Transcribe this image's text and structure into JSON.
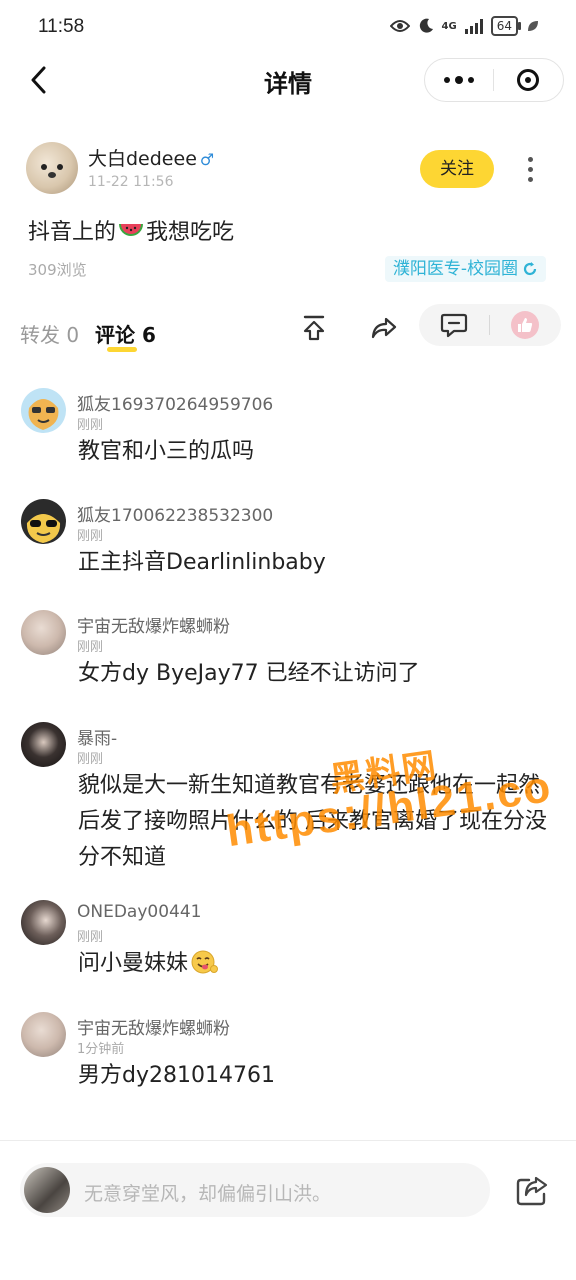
{
  "status_bar": {
    "time": "11:58",
    "battery": "64",
    "network": "4G"
  },
  "nav": {
    "title": "详情"
  },
  "post": {
    "author": "大白dedeee",
    "time": "11-22 11:56",
    "follow_label": "关注",
    "content_before": "抖音上的",
    "content_emoji": "watermelon-emoji",
    "content_after": "我想吃吃",
    "views": "309浏览",
    "circle": "濮阳医专-校园圈"
  },
  "tabs": {
    "forward": "转发 0",
    "comments": "评论 6"
  },
  "comments": [
    {
      "name": "狐友169370264959706",
      "time": "刚刚",
      "text": "教官和小三的瓜吗"
    },
    {
      "name": "狐友170062238532300",
      "time": "刚刚",
      "text": "正主抖音Dearlinlinbaby"
    },
    {
      "name": "宇宙无敌爆炸螺蛳粉",
      "time": "刚刚",
      "text": "女方dy ByeJay77 已经不让访问了"
    },
    {
      "name": "暴雨-",
      "time": "刚刚",
      "text": "貌似是大一新生知道教官有老婆还跟他在一起然后发了接吻照片什么的 后来教官离婚了现在分没分不知道"
    },
    {
      "name": "ONEDay00441",
      "time": "刚刚",
      "text": "问小曼妹妹"
    },
    {
      "name": "宇宙无敌爆炸螺蛳粉",
      "time": "1分钟前",
      "text": "男方dy281014761"
    }
  ],
  "watermark": {
    "cn": "黑料网",
    "url": "https://hl21.co"
  },
  "bottom": {
    "placeholder": "无意穿堂风，却偏偏引山洪。"
  },
  "colors": {
    "accent_yellow": "#fdd633",
    "circle_tag": "#2fb3d6",
    "watermark_orange": "#ff8c00"
  }
}
